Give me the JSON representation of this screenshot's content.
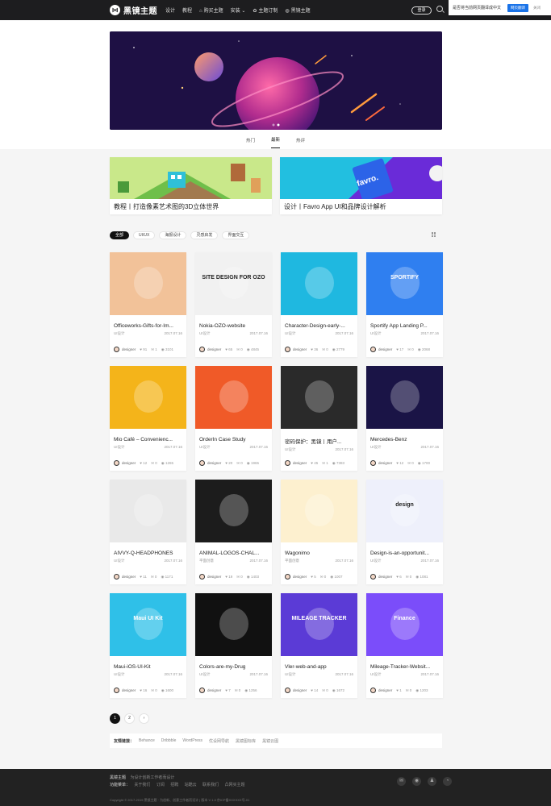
{
  "header": {
    "logo_mark": "⋈",
    "site_name": "黑镜主题",
    "nav": [
      {
        "label": "设计",
        "icon": ""
      },
      {
        "label": "教程",
        "icon": ""
      },
      {
        "label": "购买主题",
        "icon": "bag-icon"
      },
      {
        "label": "安装 ⌄",
        "icon": ""
      },
      {
        "label": "主题订制",
        "icon": "flower-icon"
      },
      {
        "label": "黑镜主题",
        "icon": "globe-icon"
      }
    ],
    "login_label": "登录"
  },
  "translate_bar": {
    "question": "是否将当前网页翻译成中文",
    "button": "网页翻译",
    "close": "关闭"
  },
  "tabs": [
    "热门",
    "最新",
    "热评"
  ],
  "active_tab": 1,
  "featured": [
    {
      "title": "教程丨打造像素艺术图的3D立体世界"
    },
    {
      "title": "设计丨Favro App UI和品牌设计解析",
      "image_text": "favro."
    }
  ],
  "filters": [
    "全部",
    "UI/UX",
    "海报设计",
    "灵感启发",
    "界面交互"
  ],
  "active_filter": 0,
  "cards": [
    {
      "title": "Officeworks-Gifts-for-Im...",
      "category": "UI设计",
      "date": "2017.07.16",
      "author": "designer",
      "likes": "91",
      "comments": "1",
      "views": "3101",
      "thumb_bg": "#f2c299",
      "thumb_text": ""
    },
    {
      "title": "Nokia-OZO-website",
      "category": "UI设计",
      "date": "2017.07.16",
      "author": "designer",
      "likes": "65",
      "comments": "0",
      "views": "4845",
      "thumb_bg": "#f1f1f1",
      "thumb_text": "SITE DESIGN FOR OZO"
    },
    {
      "title": "Character-Design-early-...",
      "category": "UI设计",
      "date": "2017.07.16",
      "author": "designer",
      "likes": "36",
      "comments": "0",
      "views": "2779",
      "thumb_bg": "#1fb8e0",
      "thumb_text": ""
    },
    {
      "title": "Sportify App Landing P...",
      "category": "UI设计",
      "date": "2017.07.16",
      "author": "designer",
      "likes": "17",
      "comments": "0",
      "views": "2068",
      "thumb_bg": "#2f7ff0",
      "thumb_text": "SPORTIFY"
    },
    {
      "title": "Mio Café – Convenienc...",
      "category": "UI设计",
      "date": "2017.07.16",
      "author": "designer",
      "likes": "12",
      "comments": "0",
      "views": "1265",
      "thumb_bg": "#f4b41a",
      "thumb_text": ""
    },
    {
      "title": "OrderIn Case Study",
      "category": "UI设计",
      "date": "2017.07.16",
      "author": "designer",
      "likes": "20",
      "comments": "0",
      "views": "1965",
      "thumb_bg": "#f05a28",
      "thumb_text": ""
    },
    {
      "title": "密码保护：黑镜丨用户...",
      "category": "UI设计",
      "date": "2017.07.16",
      "author": "designer",
      "likes": "45",
      "comments": "1",
      "views": "7383",
      "thumb_bg": "#2a2a2a",
      "thumb_text": ""
    },
    {
      "title": "Mercedes-Benz",
      "category": "UI设计",
      "date": "2017.07.16",
      "author": "designer",
      "likes": "12",
      "comments": "0",
      "views": "1700",
      "thumb_bg": "#1a1446",
      "thumb_text": ""
    },
    {
      "title": "AIVVY-Q-HEADPHONES",
      "category": "UI设计",
      "date": "2017.07.16",
      "author": "designer",
      "likes": "11",
      "comments": "0",
      "views": "1171",
      "thumb_bg": "#e9e9e9",
      "thumb_text": ""
    },
    {
      "title": "ANIMAL-LOGOS-CHAL...",
      "category": "平面创意",
      "date": "2017.07.16",
      "author": "designer",
      "likes": "19",
      "comments": "0",
      "views": "1403",
      "thumb_bg": "#1c1c1c",
      "thumb_text": ""
    },
    {
      "title": "Wagonimo",
      "category": "平面创意",
      "date": "2017.07.16",
      "author": "designer",
      "likes": "5",
      "comments": "0",
      "views": "1007",
      "thumb_bg": "#fdf0cf",
      "thumb_text": ""
    },
    {
      "title": "Design-is-an-opportunit...",
      "category": "UI设计",
      "date": "2017.07.16",
      "author": "designer",
      "likes": "6",
      "comments": "0",
      "views": "1081",
      "thumb_bg": "#eef0fb",
      "thumb_text": "design"
    },
    {
      "title": "Maui-iOS-UI-Kit",
      "category": "UI设计",
      "date": "2017.07.16",
      "author": "designer",
      "likes": "16",
      "comments": "0",
      "views": "1600",
      "thumb_bg": "#2fc0e8",
      "thumb_text": "Maui UI Kit"
    },
    {
      "title": "Colors-are-my-Drug",
      "category": "UI设计",
      "date": "2017.07.16",
      "author": "designer",
      "likes": "7",
      "comments": "0",
      "views": "1256",
      "thumb_bg": "#111111",
      "thumb_text": ""
    },
    {
      "title": "Vler-web-and-app",
      "category": "UI设计",
      "date": "2017.07.16",
      "author": "designer",
      "likes": "14",
      "comments": "0",
      "views": "1672",
      "thumb_bg": "#5b3bd6",
      "thumb_text": "MILEAGE TRACKER"
    },
    {
      "title": "Mileage-Tracker-Websit...",
      "category": "UI设计",
      "date": "2017.07.16",
      "author": "designer",
      "likes": "1",
      "comments": "0",
      "views": "1203",
      "thumb_bg": "#7b4dfa",
      "thumb_text": "Finance"
    }
  ],
  "pagination": {
    "pages": [
      "1",
      "2"
    ],
    "next": "›",
    "current": 0
  },
  "links": {
    "label": "友情链接：",
    "items": [
      "Behance",
      "Dribbble",
      "WordPress",
      "优设网导航",
      "黑镜图标库",
      "黑镜云图"
    ]
  },
  "footer": {
    "row1_label": "黑镜主题",
    "row1_text": "为设计创新工作者而设计",
    "row2_label": "功能菜单：",
    "row2_items": [
      "关于我们",
      "订阅",
      "招聘",
      "站酷云",
      "联系我们",
      "凸网买主题"
    ],
    "copyright": "Copyright © 2017-2019 黑镜主题 · 为创新、创意工作者而设计 | 版本 V 1.0 京ICP备XXXXXX号-01",
    "socials": [
      "wechat-icon",
      "weibo-icon",
      "qq-icon",
      "rss-icon"
    ]
  },
  "colors": {
    "topbar": "#1d1d1f",
    "accent": "#111111",
    "translate_button": "#1a73e8"
  }
}
